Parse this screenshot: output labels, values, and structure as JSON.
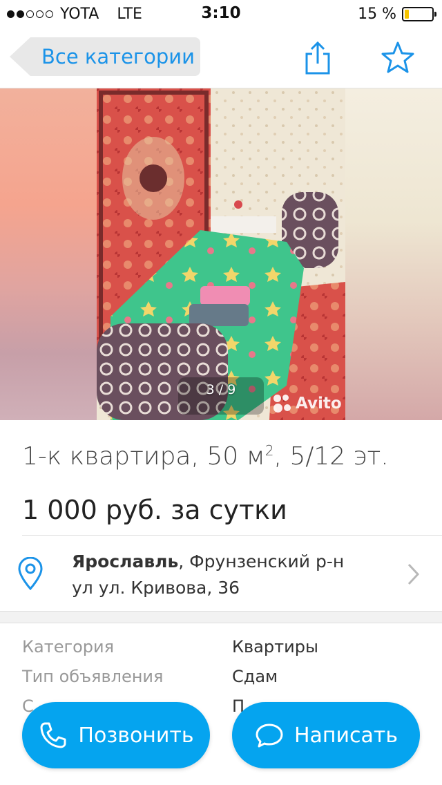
{
  "status_bar": {
    "carrier": "YOTA",
    "network": "LTE",
    "time": "3:10",
    "battery_percent_text": "15 %",
    "battery_level": 0.15,
    "signal_bars_filled": 2,
    "signal_bars_total": 5
  },
  "nav": {
    "back_label": "Все категории",
    "share_icon": "share-icon",
    "favorite_icon": "star-icon",
    "accent_color": "#1b93e8"
  },
  "gallery": {
    "counter": "3 / 9",
    "watermark": "Avito"
  },
  "listing": {
    "title_main": "1-к квартира, 50 м",
    "title_sup": "2",
    "title_rest": ", 5/12 эт.",
    "price": "1 000 руб. за сутки"
  },
  "address": {
    "city": "Ярославль",
    "district": ", Фрунзенский р-н",
    "street": "ул ул. Кривова, 36",
    "icon": "location-pin-icon"
  },
  "params": [
    {
      "label": "Категория",
      "value": "Квартиры"
    },
    {
      "label": "Тип объявления",
      "value": "Сдам"
    },
    {
      "label": "С",
      "value": "П"
    }
  ],
  "actions": {
    "call_label": "Позвонить",
    "message_label": "Написать",
    "button_color": "#05a4ef"
  }
}
